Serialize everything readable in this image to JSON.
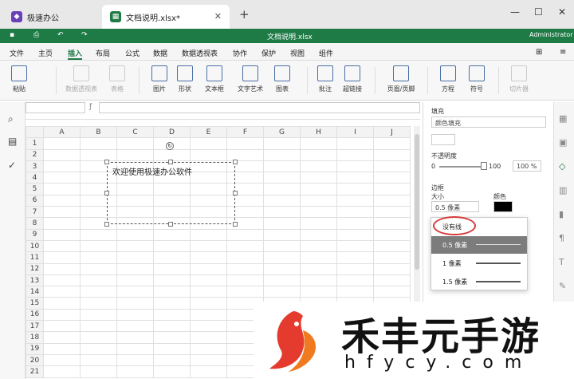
{
  "tabs": {
    "home_title": "极速办公",
    "doc_title": "文档说明.xlsx*",
    "new_tab": "+"
  },
  "window_controls": {
    "min": "—",
    "max": "☐",
    "close": "✕"
  },
  "titlebar": {
    "title": "文档说明.xlsx",
    "user": "Administrator"
  },
  "menu": [
    "文件",
    "主页",
    "插入",
    "布局",
    "公式",
    "数据",
    "数据透视表",
    "协作",
    "保护",
    "视图",
    "组件"
  ],
  "active_menu": "插入",
  "ribbon": {
    "paste": "粘贴",
    "pivot": "数据透视表",
    "table": "表格",
    "picture": "图片",
    "shape": "形状",
    "textbox": "文本框",
    "textart": "文字艺术",
    "chart": "图表",
    "comment": "批注",
    "hyperlink": "超链接",
    "header_footer": "页眉/页脚",
    "equation": "方程",
    "symbol": "符号",
    "slicer": "切片器"
  },
  "columns": [
    "A",
    "B",
    "C",
    "D",
    "E",
    "F",
    "G",
    "H",
    "I",
    "J"
  ],
  "rows": [
    "1",
    "2",
    "3",
    "4",
    "5",
    "6",
    "7",
    "8",
    "9",
    "10",
    "11",
    "12",
    "13",
    "14",
    "15",
    "16",
    "17",
    "18",
    "19",
    "20",
    "21"
  ],
  "textbox_text": "欢迎使用极速办公软件",
  "panel": {
    "fill_label": "填充",
    "fill_value": "颜色填充",
    "opacity_label": "不透明度",
    "opacity_min": "0",
    "opacity_max": "100",
    "opacity_value": "100 %",
    "border_label": "边框",
    "size_label": "大小",
    "color_label": "颜色",
    "size_value": "0.5 像素",
    "border_color": "#000000"
  },
  "dropdown": [
    "没有线",
    "0.5 像素",
    "1 像素",
    "1.5 像素"
  ],
  "watermark": {
    "big": "禾丰元手游",
    "small": "hfycy.com"
  },
  "colors": {
    "accent": "#1e7b46",
    "highlight_circle": "#d63a3a"
  }
}
